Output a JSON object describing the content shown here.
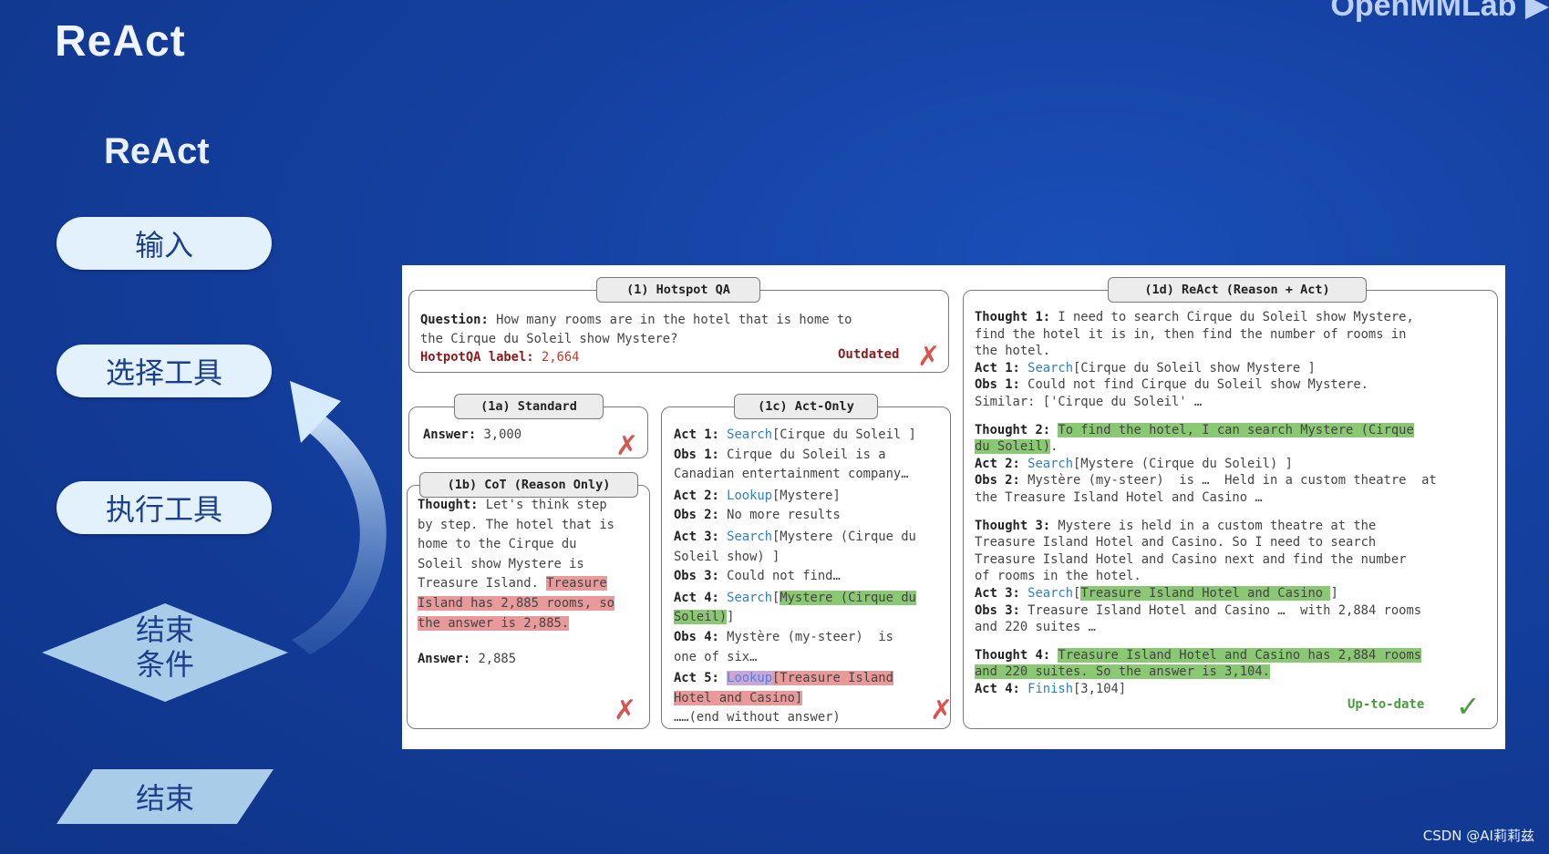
{
  "brand": "OpenMMLab",
  "page_title": "ReAct",
  "subtitle": "ReAct",
  "flow": {
    "input": "输入",
    "select_tool": "选择工具",
    "run_tool": "执行工具",
    "end_condition_line1": "结束",
    "end_condition_line2": "条件",
    "end": "结束"
  },
  "figure": {
    "hotspot": {
      "tab": "(1) Hotspot QA",
      "question_label": "Question:",
      "question_line1": " How many rooms are in the hotel that is home to",
      "question_line2": "the Cirque du Soleil show Mystere?",
      "label_key": "HotpotQA label:",
      "label_value": " 2,664",
      "status": "Outdated"
    },
    "standard": {
      "tab": "(1a) Standard",
      "answer_label": "Answer:",
      "answer_value": " 3,000"
    },
    "cot": {
      "tab": "(1b) CoT (Reason Only)",
      "thought_label": "Thought:",
      "t1": " Let's think step",
      "t2": "by step. The hotel that is",
      "t3": "home to the Cirque du",
      "t4": "Soleil show Mystere is",
      "t5a": "Treasure Island. ",
      "t5b": "Treasure",
      "t6": "Island has 2,885 rooms, so",
      "t7": "the answer is 2,885.",
      "answer_label": "Answer:",
      "answer_value": " 2,885"
    },
    "actonly": {
      "tab": "(1c) Act-Only",
      "act1_label": "Act 1:",
      "act1_tool": "Search",
      "act1_arg": "[Cirque du Soleil ]",
      "obs1_label": "Obs 1:",
      "obs1_a": " Cirque du Soleil is a",
      "obs1_b": "Canadian entertainment company…",
      "act2_label": "Act 2:",
      "act2_tool": "Lookup",
      "act2_arg": "[Mystere]",
      "obs2_label": "Obs 2:",
      "obs2": " No more results",
      "act3_label": "Act 3:",
      "act3_tool": "Search",
      "act3_arg_a": "[Mystere (Cirque du",
      "act3_arg_b": "Soleil show) ]",
      "obs3_label": "Obs 3:",
      "obs3": " Could not find…",
      "act4_label": "Act 4:",
      "act4_tool": "Search",
      "act4_arg_a": "Mystere (Cirque du",
      "act4_arg_b": "Soleil)",
      "obs4_label": "Obs 4:",
      "obs4_a": " Mystère (my-steer)  is",
      "obs4_b": "one of six…",
      "act5_label": "Act 5:",
      "act5_tool": "Lookup",
      "act5_arg_a": "[Treasure Island",
      "act5_arg_b": "Hotel and Casino]",
      "end": "……(end without answer)"
    },
    "react": {
      "tab": "(1d) ReAct (Reason + Act)",
      "th1_label": "Thought 1:",
      "th1_a": " I need to search Cirque du Soleil show Mystere,",
      "th1_b": "find the hotel it is in, then find the number of rooms in",
      "th1_c": "the hotel.",
      "a1_label": "Act 1:",
      "a1_tool": "Search",
      "a1_arg": "[Cirque du Soleil show Mystere ]",
      "o1_label": "Obs 1:",
      "o1_a": " Could not find Cirque du Soleil show Mystere.",
      "o1_b": "Similar: ['Cirque du Soleil' …",
      "th2_label": "Thought 2:",
      "th2_a": "To find the hotel, I can search Mystere (Cirque",
      "th2_b": "du Soleil)",
      "a2_label": "Act 2:",
      "a2_tool": "Search",
      "a2_arg": "[Mystere (Cirque du Soleil) ]",
      "o2_label": "Obs 2:",
      "o2_a": " Mystère (my-steer)  is …  Held in a custom theatre  at",
      "o2_b": "the Treasure Island Hotel and Casino …",
      "th3_label": "Thought 3:",
      "th3_a": " Mystere is held in a custom theatre at the",
      "th3_b": "Treasure Island Hotel and Casino. So I need to search",
      "th3_c": "Treasure Island Hotel and Casino next and find the number",
      "th3_d": "of rooms in the hotel.",
      "a3_label": "Act 3:",
      "a3_tool": "Search",
      "a3_arg": "Treasure Island Hotel and Casino ",
      "o3_label": "Obs 3:",
      "o3_a": " Treasure Island Hotel and Casino …  with 2,884 rooms",
      "o3_b": "and 220 suites …",
      "th4_label": "Thought 4:",
      "th4_a": "Treasure Island Hotel and Casino has 2,884 rooms",
      "th4_b": "and 220 suites. So the answer is 3,104.",
      "a4_label": "Act 4:",
      "a4_tool": "Finish",
      "a4_arg": "[3,104]",
      "status": "Up-to-date"
    }
  },
  "watermark": "CSDN @AI莉莉兹"
}
